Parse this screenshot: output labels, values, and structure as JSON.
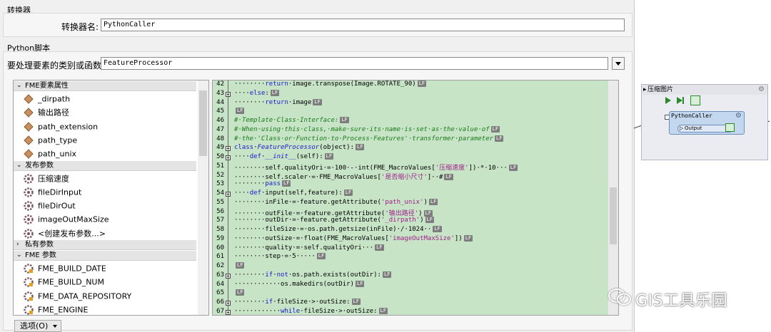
{
  "transformer_section": {
    "title": "转换器",
    "name_label": "转换器名:",
    "name_value": "PythonCaller"
  },
  "python_section": {
    "title": "Python脚本",
    "entry_label": "要处理要素的类别或函数:",
    "entry_value": "FeatureProcessor"
  },
  "tree": {
    "categories": [
      {
        "label": "FME要素属性",
        "expanded": true,
        "items": [
          "_dirpath",
          "输出路径",
          "path_extension",
          "path_type",
          "path_unix"
        ]
      },
      {
        "label": "发布参数",
        "expanded": true,
        "items": [
          "压缩速度",
          "fileDirInput",
          "fileDirOut",
          "imageOutMaxSize",
          "<创建发布参数...>"
        ]
      },
      {
        "label": "私有参数",
        "expanded": false,
        "items": []
      },
      {
        "label": "FME 参数",
        "expanded": true,
        "items": [
          "FME_BUILD_DATE",
          "FME_BUILD_NUM",
          "FME_DATA_REPOSITORY",
          "FME_ENGINE"
        ]
      }
    ]
  },
  "code_lines": [
    {
      "n": "42",
      "t": "········return·image.transpose(Image.ROTATE_90)"
    },
    {
      "n": "43",
      "t": "····else:"
    },
    {
      "n": "44",
      "t": "········return·image"
    },
    {
      "n": "45",
      "t": ""
    },
    {
      "n": "46",
      "t": "#·Template·Class·Interface:"
    },
    {
      "n": "47",
      "t": "#·When·using·this·class,·make·sure·its·name·is·set·as·the·value·of"
    },
    {
      "n": "48",
      "t": "#·the·'Class·or·Function·to·Process·Features'·transformer·parameter"
    },
    {
      "n": "49",
      "t": "class·FeatureProcessor(object):"
    },
    {
      "n": "50",
      "t": "····def·__init__(self):"
    },
    {
      "n": "51",
      "t": "········self.qualityOri·=·100·-·int(FME_MacroValues['压缩速度'])·*·10···"
    },
    {
      "n": "52",
      "t": "········self.scaler·=·FME_MacroValues['是否缩小尺寸']··#"
    },
    {
      "n": "53",
      "t": "········pass"
    },
    {
      "n": "54",
      "t": "····def·input(self,feature):"
    },
    {
      "n": "55",
      "t": "········inFile·=·feature.getAttribute('path_unix')"
    },
    {
      "n": "56",
      "t": "········outFile·=·feature.getAttribute('输出路径')"
    },
    {
      "n": "57",
      "t": "········outDir·=·feature.getAttribute('_dirpath')"
    },
    {
      "n": "58",
      "t": "········fileSize·=·os.path.getsize(inFile)·/·1024··"
    },
    {
      "n": "59",
      "t": "········outSize·=·float(FME_MacroValues['imageOutMaxSize'])"
    },
    {
      "n": "60",
      "t": "········quality·=·self.qualityOri···"
    },
    {
      "n": "61",
      "t": "········step·=·5·····"
    },
    {
      "n": "62",
      "t": ""
    },
    {
      "n": "63",
      "t": "········if·not·os.path.exists(outDir):"
    },
    {
      "n": "64",
      "t": "············os.makedirs(outDir)"
    },
    {
      "n": "65",
      "t": ""
    },
    {
      "n": "66",
      "t": "········if·fileSize·>·outSize:"
    },
    {
      "n": "67",
      "t": "············while·fileSize·>·outSize:"
    }
  ],
  "lf_marker": "LF",
  "options_button": "选项(O)",
  "canvas": {
    "bookmark_title": "压缩图片",
    "node_name": "PythonCaller",
    "output_port": "Output"
  },
  "watermark": "GIS工具乐园",
  "colors": {
    "code_bg": "#c7e4c7",
    "keyword": "#1a1acc",
    "comment": "#1a7a1a",
    "string": "#a0208a",
    "node": "#c3d7ef"
  }
}
